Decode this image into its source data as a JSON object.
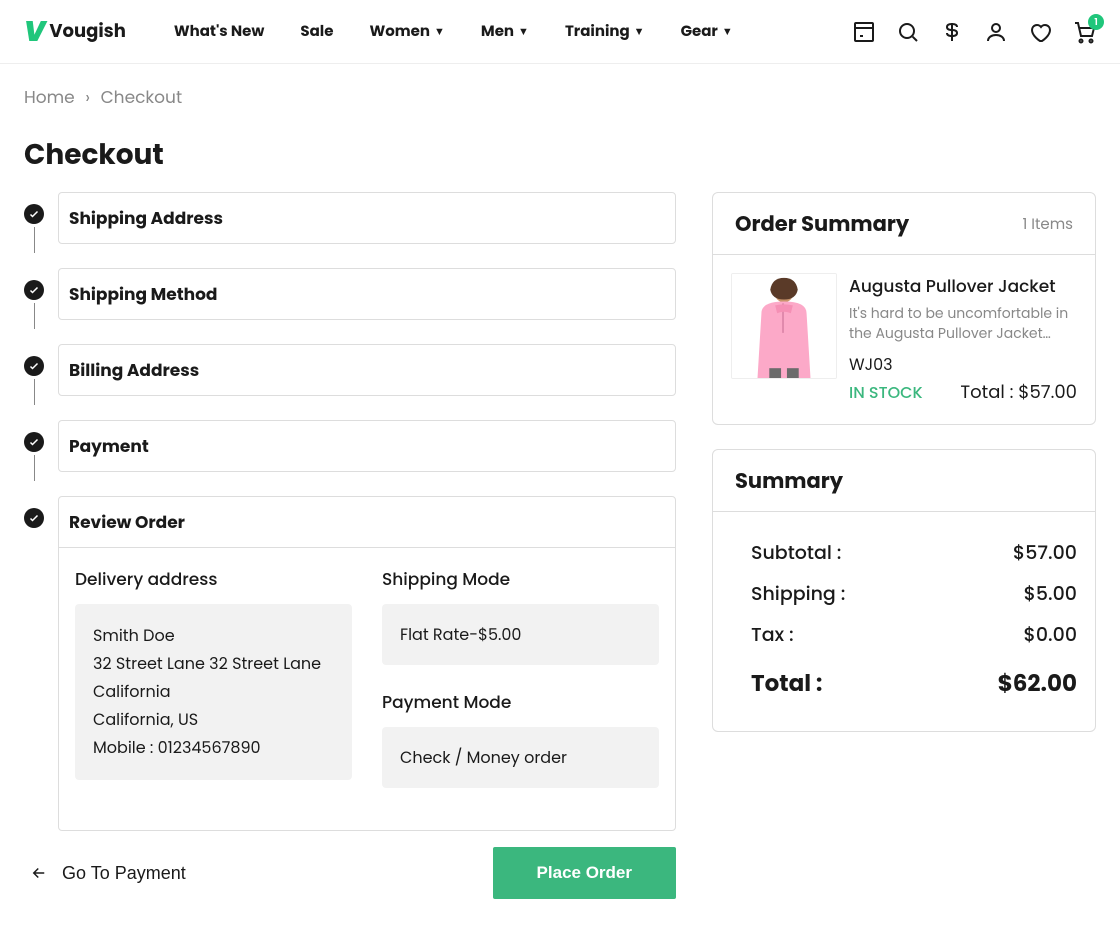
{
  "brand": "Vougish",
  "nav": {
    "whats_new": "What's New",
    "sale": "Sale",
    "women": "Women",
    "men": "Men",
    "training": "Training",
    "gear": "Gear"
  },
  "cart_count": "1",
  "breadcrumb": {
    "home": "Home",
    "current": "Checkout"
  },
  "page_title": "Checkout",
  "steps": {
    "shipping_address": "Shipping Address",
    "shipping_method": "Shipping Method",
    "billing_address": "Billing Address",
    "payment": "Payment",
    "review": "Review Order"
  },
  "review": {
    "delivery_label": "Delivery address",
    "shipping_label": "Shipping Mode",
    "payment_label": "Payment Mode",
    "address": {
      "name": "Smith Doe",
      "line1": "32 Street Lane 32 Street Lane",
      "city": "California",
      "region": "California, US",
      "mobile": "Mobile : 01234567890"
    },
    "shipping_mode": "Flat Rate-$5.00",
    "payment_mode": "Check / Money order"
  },
  "actions": {
    "back": "Go To Payment",
    "place": "Place Order"
  },
  "order": {
    "title": "Order Summary",
    "items_label": "1 Items",
    "product": {
      "name": "Augusta Pullover Jacket",
      "desc": "It's hard to be uncomfortable in the Augusta Pullover Jacket…",
      "sku": "WJ03",
      "stock": "IN STOCK",
      "total": "Total : $57.00"
    }
  },
  "summary": {
    "title": "Summary",
    "subtotal_lbl": "Subtotal :",
    "subtotal": "$57.00",
    "shipping_lbl": "Shipping :",
    "shipping": "$5.00",
    "tax_lbl": "Tax :",
    "tax": "$0.00",
    "total_lbl": "Total :",
    "total": "$62.00"
  }
}
